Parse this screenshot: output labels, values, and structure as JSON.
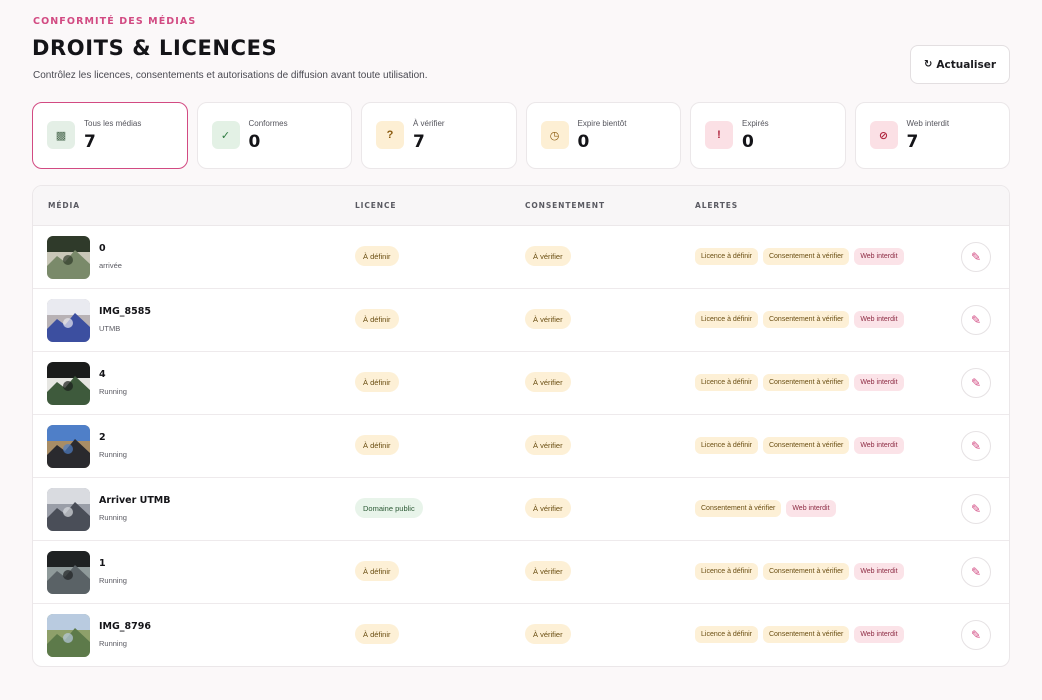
{
  "header": {
    "eyebrow": "CONFORMITÉ DES MÉDIAS",
    "title": "DROITS & LICENCES",
    "subtitle": "Contrôlez les licences, consentements et autorisations de diffusion avant toute utilisation.",
    "refresh_label": "Actualiser",
    "refresh_icon": "↻"
  },
  "stats": [
    {
      "label": "Tous les médias",
      "value": "7",
      "icon": "▩",
      "icon_name": "grid-icon",
      "icon_bg": "#e4efe6",
      "icon_color": "#4d6b52"
    },
    {
      "label": "Conformes",
      "value": "0",
      "icon": "✓",
      "icon_name": "check-icon",
      "icon_bg": "#e3f1e5",
      "icon_color": "#2c7a3f"
    },
    {
      "label": "À vérifier",
      "value": "7",
      "icon": "?",
      "icon_name": "question-icon",
      "icon_bg": "#fdefd4",
      "icon_color": "#8a5a0e"
    },
    {
      "label": "Expire bientôt",
      "value": "0",
      "icon": "◷",
      "icon_name": "clock-icon",
      "icon_bg": "#fdefd4",
      "icon_color": "#8a5a0e"
    },
    {
      "label": "Expirés",
      "value": "0",
      "icon": "!",
      "icon_name": "alert-icon",
      "icon_bg": "#fbe0e5",
      "icon_color": "#b0263f"
    },
    {
      "label": "Web interdit",
      "value": "7",
      "icon": "⊘",
      "icon_name": "forbidden-icon",
      "icon_bg": "#fbe0e5",
      "icon_color": "#b0263f"
    }
  ],
  "table": {
    "columns": [
      "MÉDIA",
      "LICENCE",
      "CONSENTEMENT",
      "ALERTES"
    ],
    "rows": [
      {
        "name": "0",
        "sub": "arrivée",
        "licence": "À définir",
        "licence_type": "warn",
        "consent": "À vérifier",
        "alerts": [
          {
            "text": "Licence à définir",
            "type": "warn"
          },
          {
            "text": "Consentement à vérifier",
            "type": "warn"
          },
          {
            "text": "Web interdit",
            "type": "danger"
          }
        ],
        "thumb": [
          "#2f3a2a",
          "#7a8a6a",
          "#c9c7b8"
        ]
      },
      {
        "name": "IMG_8585",
        "sub": "UTMB",
        "licence": "À définir",
        "licence_type": "warn",
        "consent": "À vérifier",
        "alerts": [
          {
            "text": "Licence à définir",
            "type": "warn"
          },
          {
            "text": "Consentement à vérifier",
            "type": "warn"
          },
          {
            "text": "Web interdit",
            "type": "danger"
          }
        ],
        "thumb": [
          "#e9eaf0",
          "#3c4fa0",
          "#b8b2b5"
        ]
      },
      {
        "name": "4",
        "sub": "Running",
        "licence": "À définir",
        "licence_type": "warn",
        "consent": "À vérifier",
        "alerts": [
          {
            "text": "Licence à définir",
            "type": "warn"
          },
          {
            "text": "Consentement à vérifier",
            "type": "warn"
          },
          {
            "text": "Web interdit",
            "type": "danger"
          }
        ],
        "thumb": [
          "#1a1c1b",
          "#3e5a3c",
          "#e6e6e2"
        ]
      },
      {
        "name": "2",
        "sub": "Running",
        "licence": "À définir",
        "licence_type": "warn",
        "consent": "À vérifier",
        "alerts": [
          {
            "text": "Licence à définir",
            "type": "warn"
          },
          {
            "text": "Consentement à vérifier",
            "type": "warn"
          },
          {
            "text": "Web interdit",
            "type": "danger"
          }
        ],
        "thumb": [
          "#4f7fc8",
          "#2a2a2e",
          "#a88d66"
        ]
      },
      {
        "name": "Arriver UTMB",
        "sub": "Running",
        "licence": "Domaine public",
        "licence_type": "ok",
        "consent": "À vérifier",
        "alerts": [
          {
            "text": "Consentement à vérifier",
            "type": "warn"
          },
          {
            "text": "Web interdit",
            "type": "danger"
          }
        ],
        "thumb": [
          "#d9dbe0",
          "#4a4e58",
          "#9a9ea8"
        ]
      },
      {
        "name": "1",
        "sub": "Running",
        "licence": "À définir",
        "licence_type": "warn",
        "consent": "À vérifier",
        "alerts": [
          {
            "text": "Licence à définir",
            "type": "warn"
          },
          {
            "text": "Consentement à vérifier",
            "type": "warn"
          },
          {
            "text": "Web interdit",
            "type": "danger"
          }
        ],
        "thumb": [
          "#1f2223",
          "#5a6266",
          "#8f9a9a"
        ]
      },
      {
        "name": "IMG_8796",
        "sub": "Running",
        "licence": "À définir",
        "licence_type": "warn",
        "consent": "À vérifier",
        "alerts": [
          {
            "text": "Licence à définir",
            "type": "warn"
          },
          {
            "text": "Consentement à vérifier",
            "type": "warn"
          },
          {
            "text": "Web interdit",
            "type": "danger"
          }
        ],
        "thumb": [
          "#b9cbe0",
          "#5d7a4a",
          "#8ea06a"
        ]
      }
    ]
  },
  "colors": {
    "accent": "#d24a82",
    "warn_bg": "#fdf0d6",
    "ok_bg": "#e8f4ea",
    "danger_bg": "#fbe3e8"
  }
}
